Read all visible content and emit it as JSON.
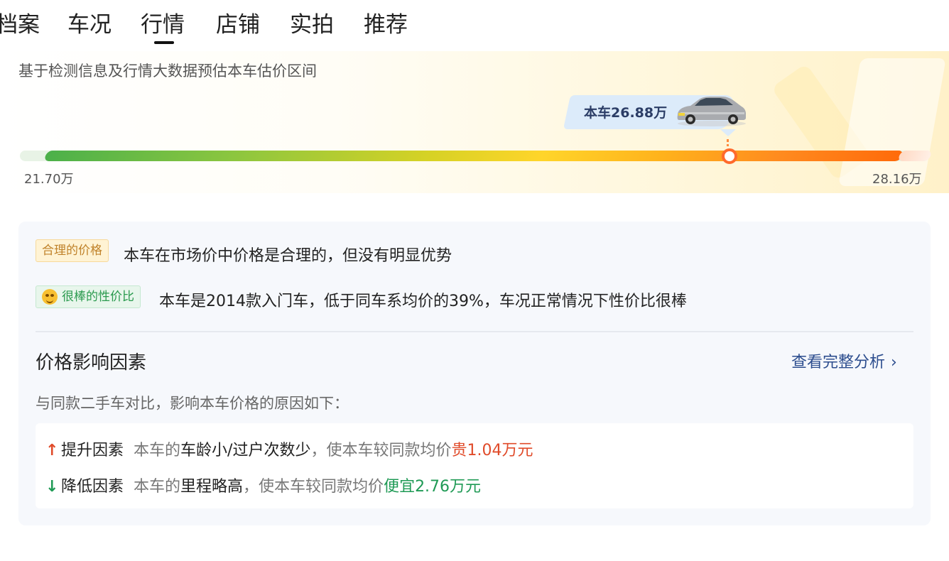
{
  "tabs": [
    {
      "label": "档案",
      "active": false
    },
    {
      "label": "车况",
      "active": false
    },
    {
      "label": "行情",
      "active": true
    },
    {
      "label": "店铺",
      "active": false
    },
    {
      "label": "实拍",
      "active": false
    },
    {
      "label": "推荐",
      "active": false
    }
  ],
  "estimate": {
    "subtitle": "基于检测信息及行情大数据预估本车估价区间",
    "current_label": "本车26.88万",
    "low": "21.70万",
    "high": "28.16万",
    "car_icon": "car-icon"
  },
  "analysis": {
    "badge_reasonable": "合理的价格",
    "line_reasonable": "本车在市场价中价格是合理的，但没有明显优势",
    "badge_value": "很棒的性价比",
    "badge_value_icon": "smile-emoji-icon",
    "line_value": "本车是2014款入门车，低于同车系均价的39%，车况正常情况下性价比很棒"
  },
  "factors_section": {
    "title": "价格影响因素",
    "more_link": "查看完整分析",
    "intro": "与同款二手车对比，影响本车价格的原因如下：",
    "up": {
      "arrow": "↑",
      "label": "提升因素",
      "prefix": "本车的",
      "reason": "车龄小/过户次数少",
      "middle": "，使本车较同款均价",
      "impact": "贵1.04万元"
    },
    "down": {
      "arrow": "↓",
      "label": "降低因素",
      "prefix": "本车的",
      "reason": "里程略高",
      "middle": "，使本车较同款均价",
      "impact": "便宜2.76万元"
    }
  },
  "colors": {
    "up": "#e04b2a",
    "down": "#1f9a55",
    "link": "#2c4d8e",
    "marker": "#ff6a2c"
  }
}
